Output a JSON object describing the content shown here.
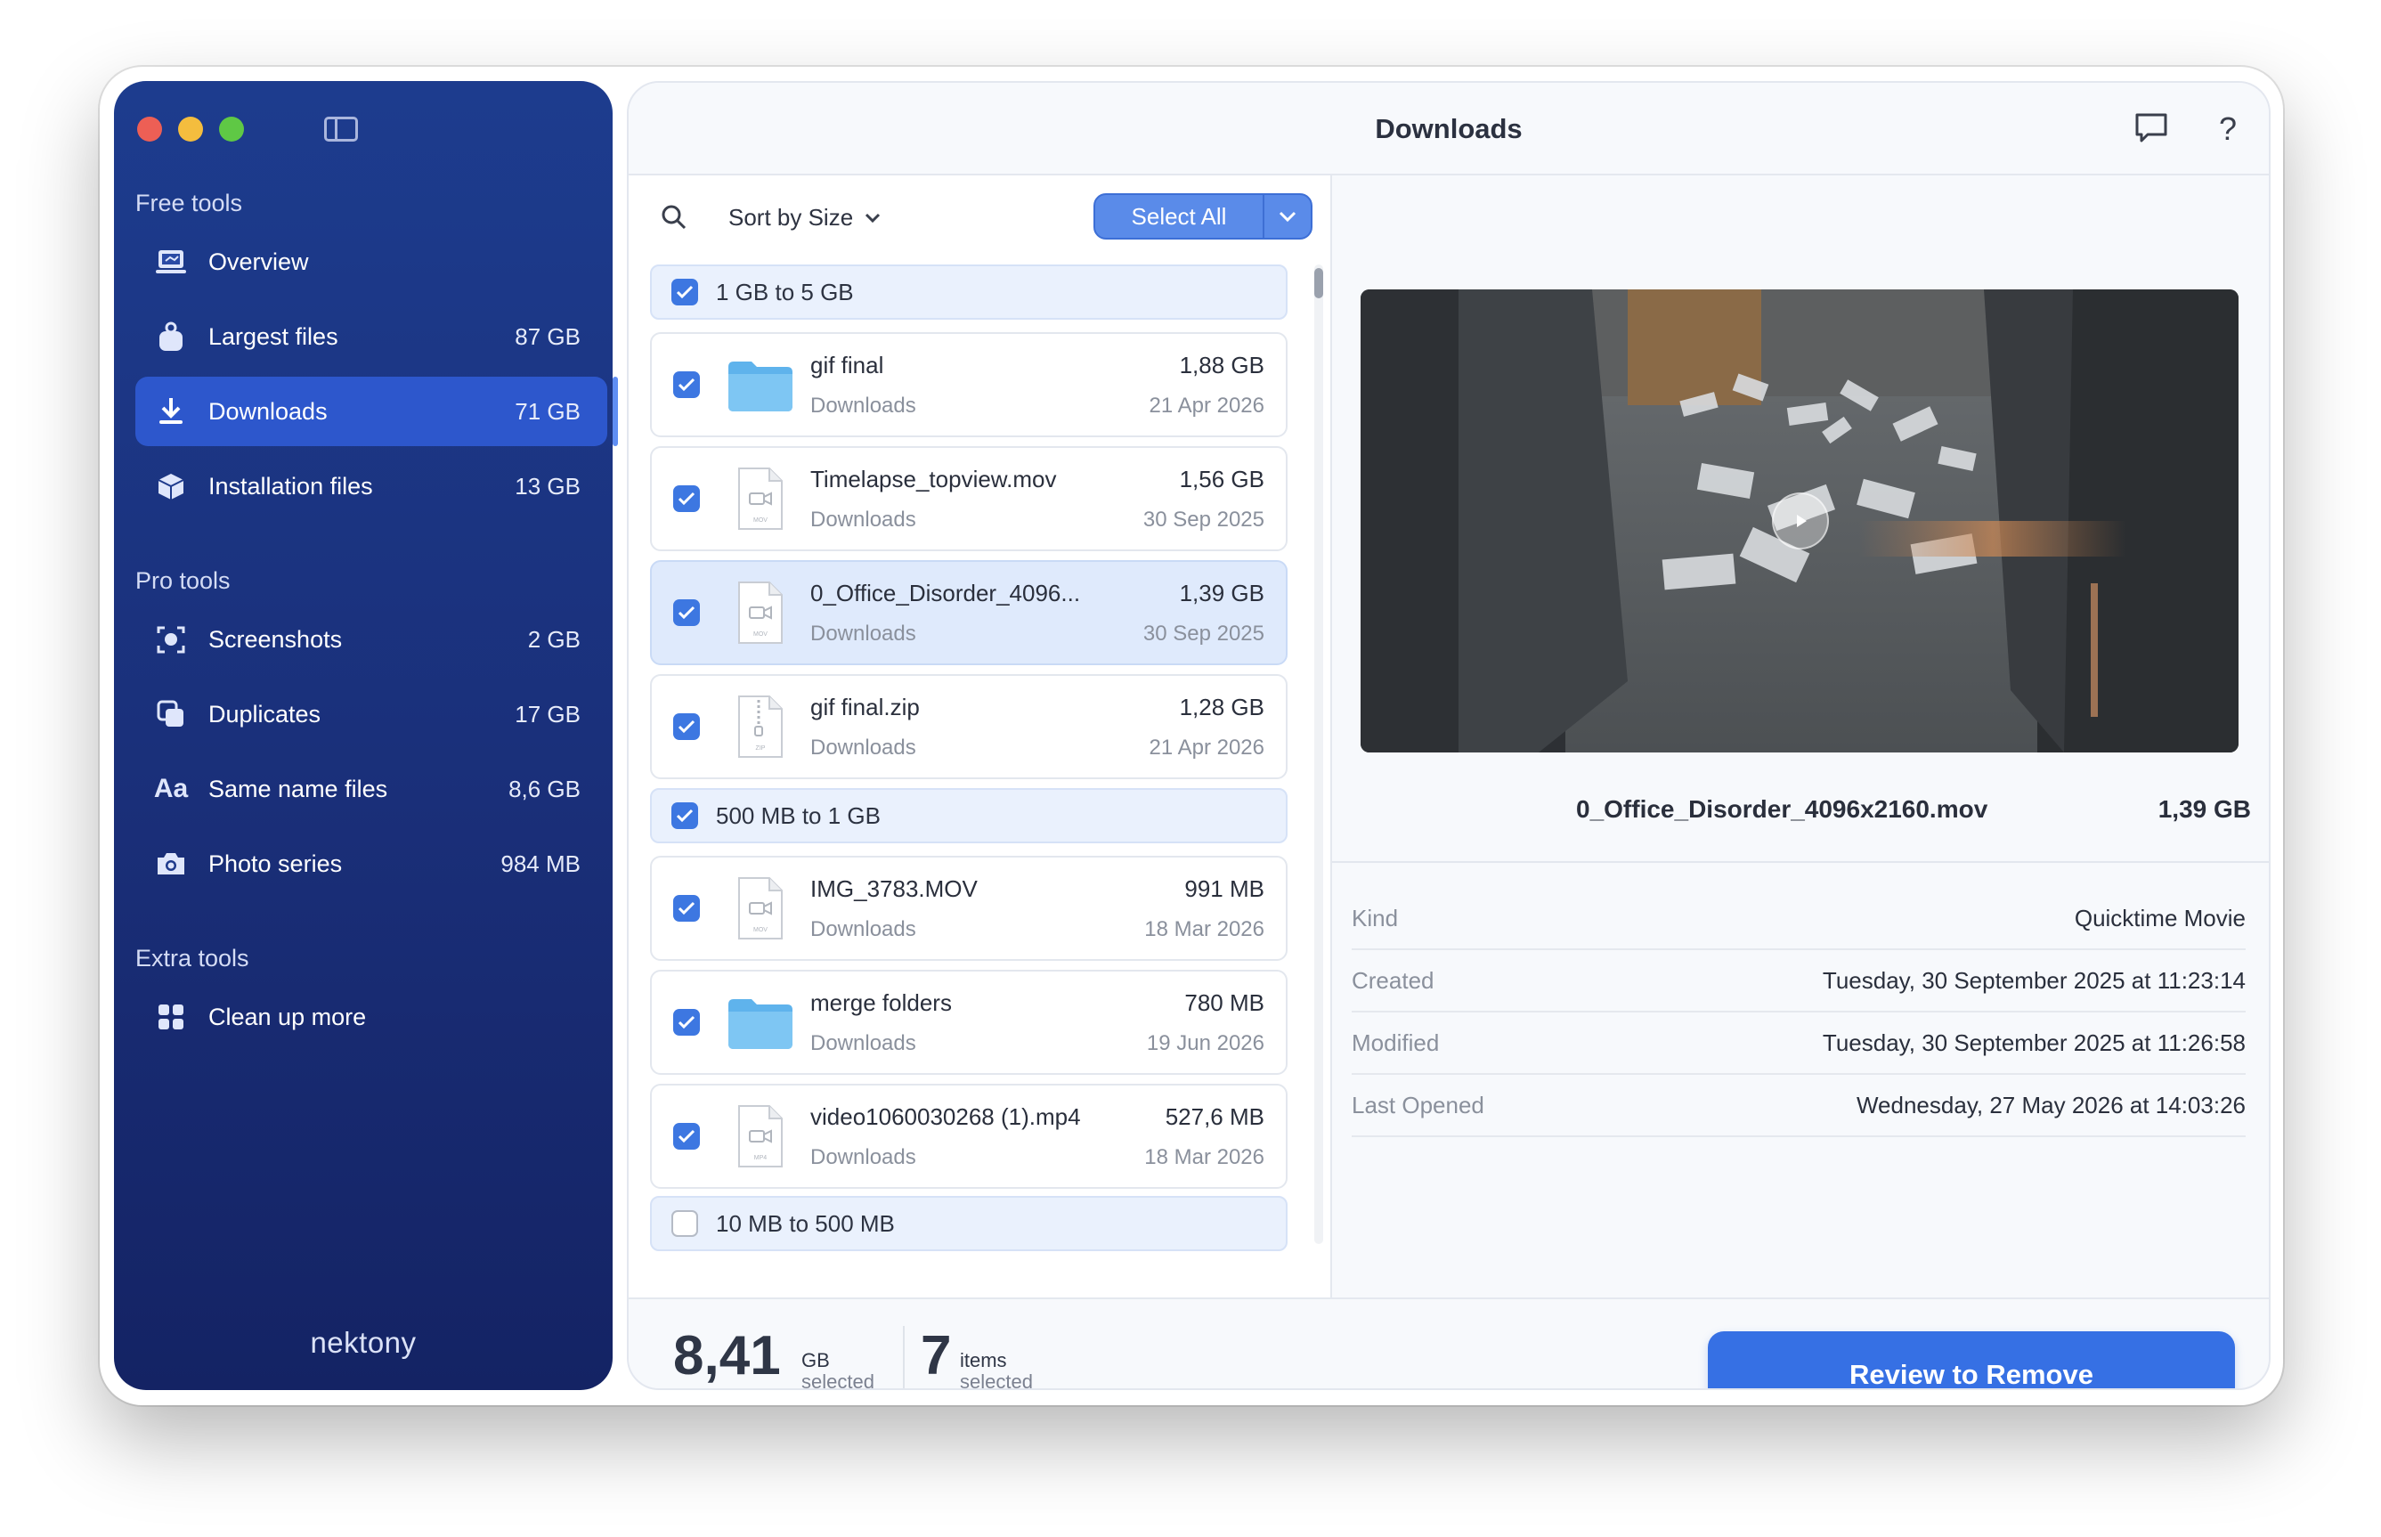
{
  "window": {
    "title": "Downloads"
  },
  "sidebar": {
    "sections": [
      {
        "title": "Free tools"
      },
      {
        "title": "Pro tools"
      },
      {
        "title": "Extra tools"
      }
    ],
    "items": [
      {
        "label": "Overview",
        "size": "",
        "icon": "laptop-icon"
      },
      {
        "label": "Largest files",
        "size": "87 GB",
        "icon": "weight-icon"
      },
      {
        "label": "Downloads",
        "size": "71 GB",
        "icon": "download-icon",
        "active": true
      },
      {
        "label": "Installation files",
        "size": "13 GB",
        "icon": "package-icon"
      },
      {
        "label": "Screenshots",
        "size": "2 GB",
        "icon": "screenshot-icon"
      },
      {
        "label": "Duplicates",
        "size": "17 GB",
        "icon": "duplicates-icon"
      },
      {
        "label": "Same name files",
        "size": "8,6 GB",
        "icon": "text-aa-icon",
        "glyph": "Aa"
      },
      {
        "label": "Photo series",
        "size": "984 MB",
        "icon": "camera-icon"
      },
      {
        "label": "Clean up more",
        "size": "",
        "icon": "grid-icon"
      }
    ],
    "brand": "nektony"
  },
  "toolbar": {
    "sort_label": "Sort by Size",
    "select_all_label": "Select All"
  },
  "groups": [
    {
      "label": "1 GB to 5 GB",
      "checked": true
    },
    {
      "label": "500 MB to 1 GB",
      "checked": true
    },
    {
      "label": "10 MB to 500 MB",
      "checked": false
    }
  ],
  "files": [
    {
      "name": "gif final",
      "location": "Downloads",
      "size": "1,88 GB",
      "date": "21 Apr 2026",
      "type": "folder",
      "checked": true
    },
    {
      "name": "Timelapse_topview.mov",
      "location": "Downloads",
      "size": "1,56 GB",
      "date": "30 Sep 2025",
      "type": "MOV",
      "checked": true
    },
    {
      "name": "0_Office_Disorder_4096...",
      "location": "Downloads",
      "size": "1,39 GB",
      "date": "30 Sep 2025",
      "type": "MOV",
      "checked": true,
      "selected": true
    },
    {
      "name": "gif final.zip",
      "location": "Downloads",
      "size": "1,28 GB",
      "date": "21 Apr 2026",
      "type": "ZIP",
      "checked": true
    },
    {
      "name": "IMG_3783.MOV",
      "location": "Downloads",
      "size": "991 MB",
      "date": "18 Mar 2026",
      "type": "MOV",
      "checked": true
    },
    {
      "name": "merge folders",
      "location": "Downloads",
      "size": "780 MB",
      "date": "19 Jun 2026",
      "type": "folder",
      "checked": true
    },
    {
      "name": "video1060030268 (1).mp4",
      "location": "Downloads",
      "size": "527,6 MB",
      "date": "18 Mar 2026",
      "type": "MP4",
      "checked": true
    }
  ],
  "preview": {
    "filename": "0_Office_Disorder_4096x2160.mov",
    "size": "1,39 GB",
    "info": [
      {
        "key": "Kind",
        "value": "Quicktime Movie"
      },
      {
        "key": "Created",
        "value": "Tuesday, 30 September 2025 at 11:23:14"
      },
      {
        "key": "Modified",
        "value": "Tuesday, 30 September 2025 at 11:26:58"
      },
      {
        "key": "Last Opened",
        "value": "Wednesday, 27 May 2026 at 14:03:26"
      }
    ]
  },
  "footer": {
    "size_value": "8,41",
    "size_unit": "GB",
    "size_sub": "selected",
    "count_value": "7",
    "count_unit": "items",
    "count_sub": "selected",
    "review_label": "Review to Remove"
  },
  "colors": {
    "accent": "#3670e4",
    "sidebar": "#1a2f79",
    "checkbox": "#3d77e1"
  }
}
